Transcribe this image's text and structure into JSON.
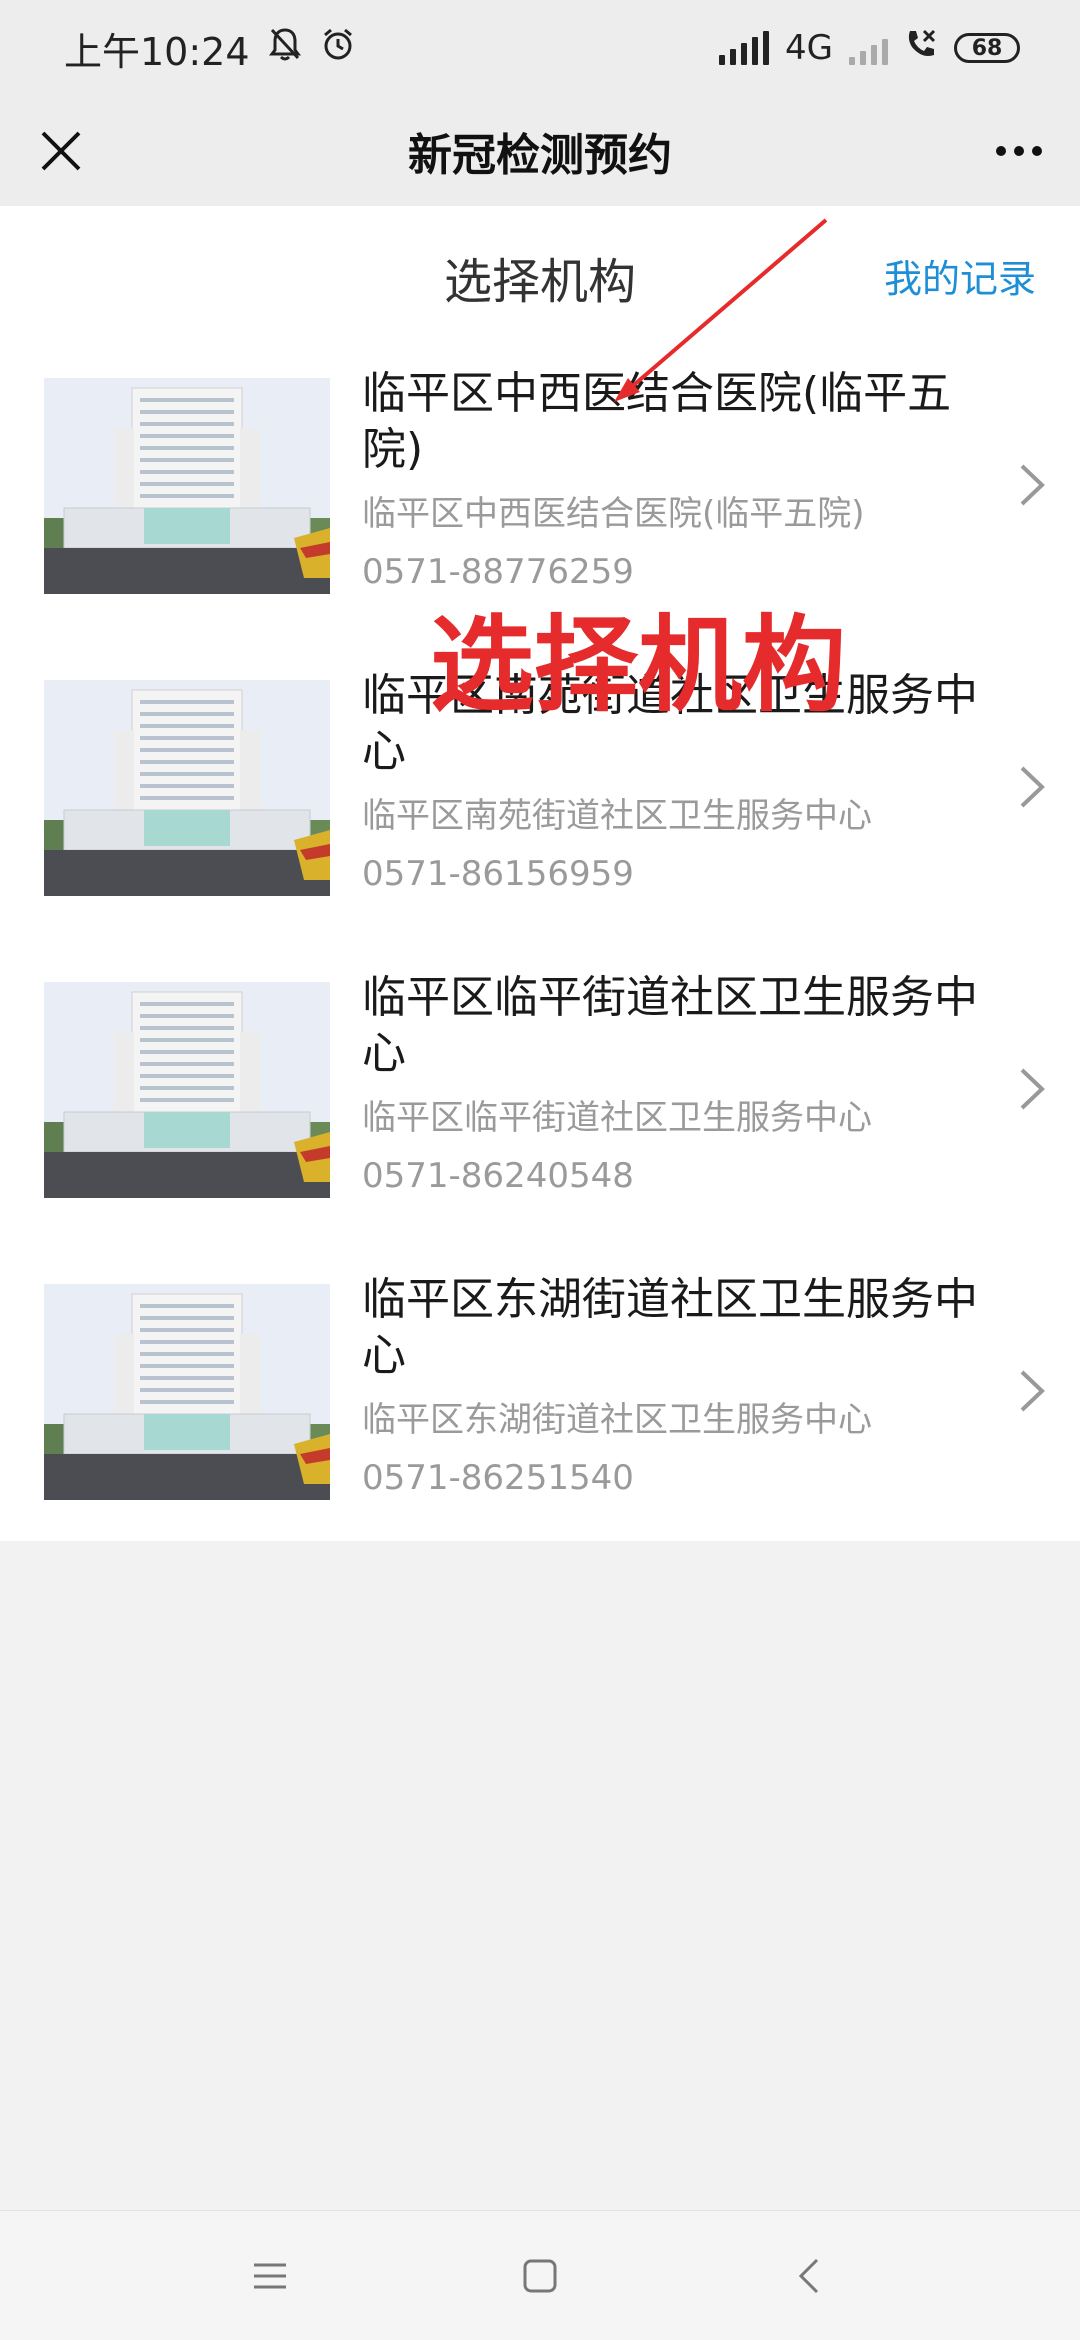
{
  "status_bar": {
    "time": "上午10:24",
    "network": "4G",
    "battery": "68",
    "icons": [
      "mute-bell-icon",
      "alarm-icon",
      "signal-icon",
      "signal-weak-icon",
      "call-icon",
      "battery-icon"
    ]
  },
  "title_bar": {
    "title": "新冠检测预约",
    "close_icon": "close-icon",
    "more_icon": "more-icon"
  },
  "section": {
    "title": "选择机构",
    "records_link": "我的记录"
  },
  "institutions": [
    {
      "name": "临平区中西医结合医院(临平五院)",
      "subtitle": "临平区中西医结合医院(临平五院)",
      "phone": "0571-88776259"
    },
    {
      "name": "临平区南苑街道社区卫生服务中心",
      "subtitle": "临平区南苑街道社区卫生服务中心",
      "phone": "0571-86156959"
    },
    {
      "name": "临平区临平街道社区卫生服务中心",
      "subtitle": "临平区临平街道社区卫生服务中心",
      "phone": "0571-86240548"
    },
    {
      "name": "临平区东湖街道社区卫生服务中心",
      "subtitle": "临平区东湖街道社区卫生服务中心",
      "phone": "0571-86251540"
    }
  ],
  "annotation": {
    "text": "选择机构",
    "color": "#e52b2b"
  },
  "colors": {
    "link": "#1e8fd6",
    "annotation": "#e52b2b"
  },
  "nav_bar": {
    "icons": [
      "menu-icon",
      "home-icon",
      "back-icon"
    ]
  }
}
